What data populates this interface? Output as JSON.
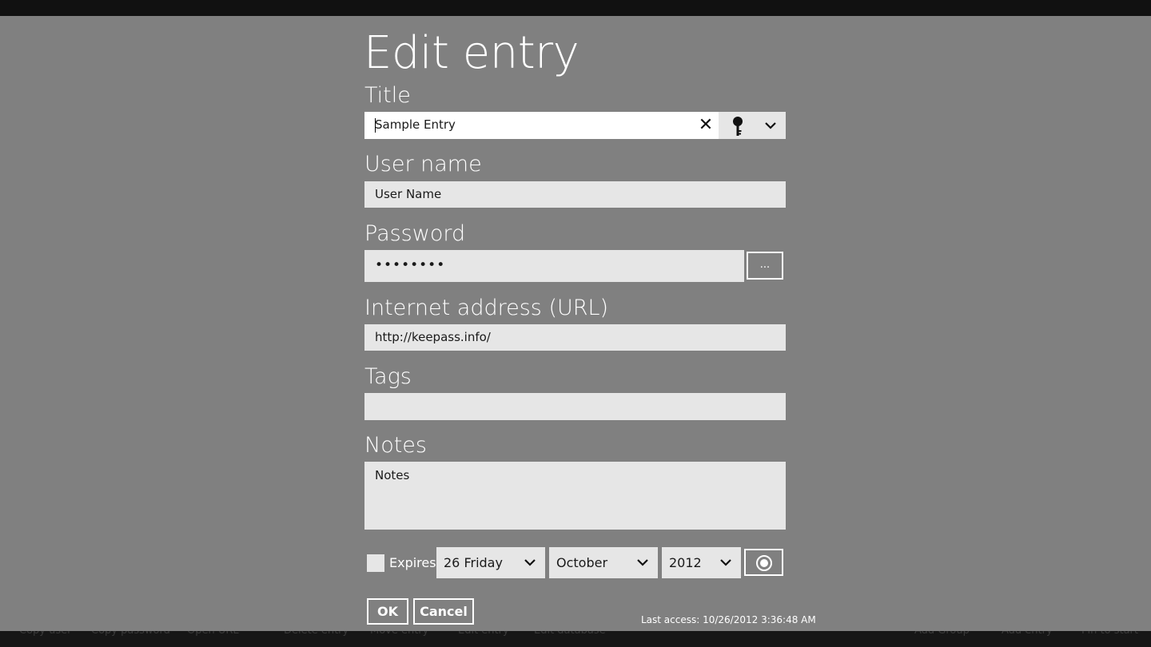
{
  "page": {
    "heading": "Edit entry"
  },
  "title": {
    "label": "Title",
    "value": "Sample Entry"
  },
  "username": {
    "label": "User name",
    "value": "User Name"
  },
  "password": {
    "label": "Password",
    "masked_value": "••••••••",
    "generate_button": "..."
  },
  "url": {
    "label": "Internet address (URL)",
    "value": "http://keepass.info/"
  },
  "tags": {
    "label": "Tags",
    "value": ""
  },
  "notes": {
    "label": "Notes",
    "value": "Notes"
  },
  "expiry": {
    "checkbox_label": "Expires",
    "checked": false,
    "day": "26 Friday",
    "month": "October",
    "year": "2012"
  },
  "actions": {
    "ok": "OK",
    "cancel": "Cancel"
  },
  "status": {
    "last_access": "Last access: 10/26/2012 3:36:48 AM"
  },
  "appbar": {
    "copy_user": "Copy user",
    "copy_password": "Copy password",
    "open_url": "Open URL",
    "delete_entry": "Delete entry",
    "move_entry": "Move entry",
    "edit_entry": "Edit entry",
    "edit_database": "Edit database",
    "add_group": "Add Group",
    "add_entry": "Add entry",
    "pin_to_start": "Pin to start"
  },
  "colors": {
    "overlay": "#808080",
    "field": "#e6e6e6",
    "appbar": "#161616"
  }
}
